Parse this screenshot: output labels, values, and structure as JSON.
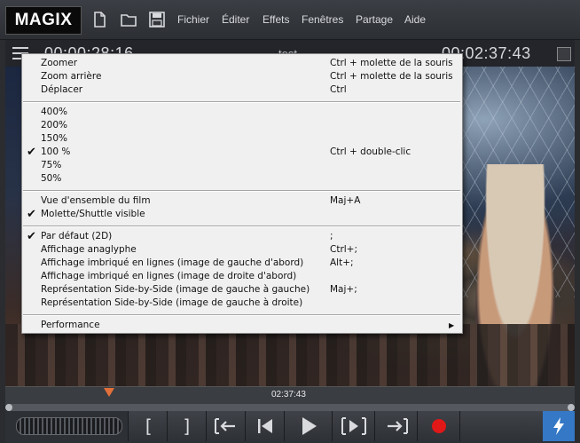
{
  "app": {
    "logo": "MAGIX",
    "menu": [
      "Fichier",
      "Éditer",
      "Effets",
      "Fenêtres",
      "Partage",
      "Aide"
    ],
    "toolbar_icons": [
      "new-file-icon",
      "open-folder-icon",
      "save-icon"
    ]
  },
  "monitor": {
    "title": "test",
    "timecode_left": "00:00:28:16",
    "timecode_right": "00:02:37:43",
    "timeline_time": "02:37:43"
  },
  "transport": {
    "buttons": [
      "in-marker",
      "out-marker",
      "jump-to-start",
      "previous-frame",
      "play",
      "next-marker",
      "jump-to-end",
      "record"
    ],
    "labels": {
      "in": "[",
      "out": "]"
    }
  },
  "context_menu": {
    "groups": [
      [
        {
          "label": "Zoomer",
          "shortcut": "Ctrl + molette de la souris",
          "checked": false
        },
        {
          "label": "Zoom arrière",
          "shortcut": "Ctrl + molette de la souris",
          "checked": false
        },
        {
          "label": "Déplacer",
          "shortcut": "Ctrl",
          "checked": false
        }
      ],
      [
        {
          "label": "400%",
          "shortcut": "",
          "checked": false
        },
        {
          "label": "200%",
          "shortcut": "",
          "checked": false
        },
        {
          "label": "150%",
          "shortcut": "",
          "checked": false
        },
        {
          "label": "100 %",
          "shortcut": "Ctrl + double-clic",
          "checked": true
        },
        {
          "label": "75%",
          "shortcut": "",
          "checked": false
        },
        {
          "label": "50%",
          "shortcut": "",
          "checked": false
        }
      ],
      [
        {
          "label": "Vue d'ensemble du film",
          "shortcut": "Maj+A",
          "checked": false
        },
        {
          "label": "Molette/Shuttle visible",
          "shortcut": "",
          "checked": true
        }
      ],
      [
        {
          "label": "Par défaut (2D)",
          "shortcut": ";",
          "checked": true
        },
        {
          "label": "Affichage anaglyphe",
          "shortcut": "Ctrl+;",
          "checked": false
        },
        {
          "label": "Affichage imbriqué en lignes (image de gauche d'abord)",
          "shortcut": "Alt+;",
          "checked": false
        },
        {
          "label": "Affichage imbriqué en lignes (image de droite d'abord)",
          "shortcut": "",
          "checked": false
        },
        {
          "label": "Représentation Side-by-Side (image de gauche à gauche)",
          "shortcut": "Maj+;",
          "checked": false
        },
        {
          "label": "Représentation Side-by-Side (image de gauche à droite)",
          "shortcut": "",
          "checked": false
        }
      ],
      [
        {
          "label": "Performance",
          "shortcut": "",
          "checked": false,
          "submenu": true
        }
      ]
    ]
  }
}
